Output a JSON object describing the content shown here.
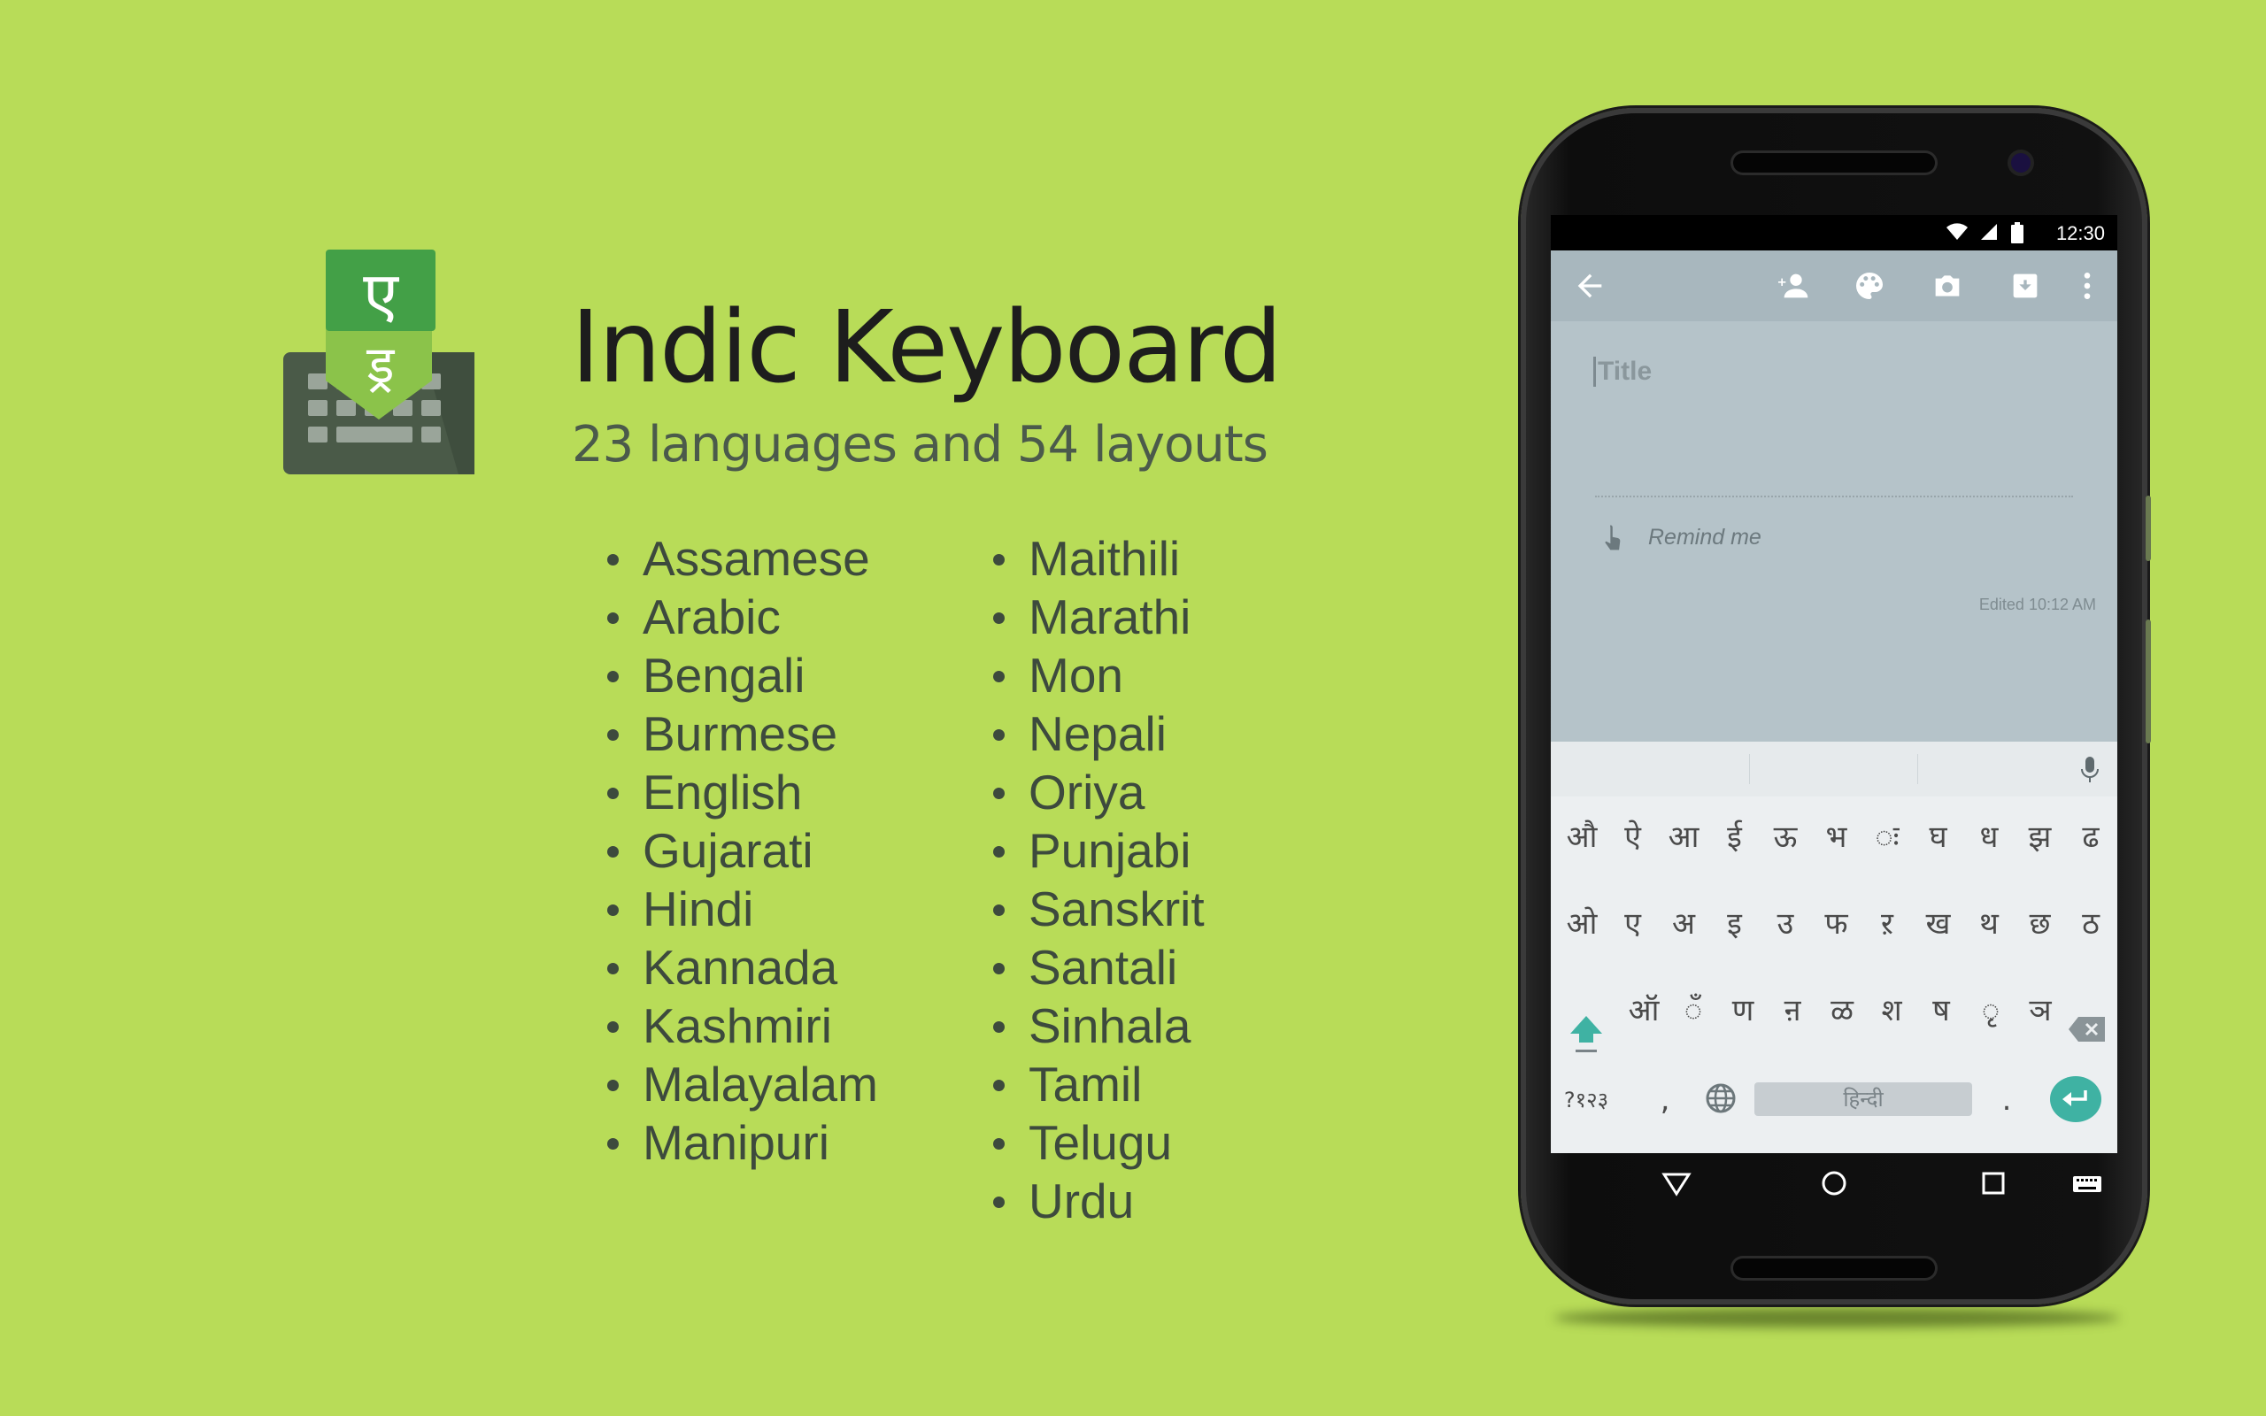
{
  "header": {
    "title": "Indic Keyboard",
    "subtitle": "23 languages and 54 layouts"
  },
  "app_icon": {
    "glyph_top": "ए",
    "glyph_bottom": "ड्र",
    "colors": {
      "badge": "#43a047",
      "ribbon": "#8bc34a",
      "keyboard": "#4a5a48"
    }
  },
  "languages": {
    "column1": [
      "Assamese",
      "Arabic",
      "Bengali",
      "Burmese",
      "English",
      "Gujarati",
      "Hindi",
      "Kannada",
      "Kashmiri",
      "Malayalam",
      "Manipuri"
    ],
    "column2": [
      "Maithili",
      "Marathi",
      "Mon",
      "Nepali",
      "Oriya",
      "Punjabi",
      "Sanskrit",
      "Santali",
      "Sinhala",
      "Tamil",
      "Telugu",
      "Urdu"
    ]
  },
  "phone": {
    "status_bar": {
      "time": "12:30",
      "icons": [
        "wifi-icon",
        "signal-icon",
        "battery-icon"
      ]
    },
    "toolbar": {
      "icons": [
        "back-arrow-icon",
        "add-person-icon",
        "palette-icon",
        "camera-icon",
        "archive-icon",
        "more-vert-icon"
      ]
    },
    "note": {
      "title_placeholder": "Title",
      "remind_label": "Remind me",
      "edited_label": "Edited 10:12 AM"
    },
    "keyboard": {
      "row1": [
        "औ",
        "ऐ",
        "आ",
        "ई",
        "ऊ",
        "भ",
        "ः",
        "घ",
        "ध",
        "झ",
        "ढ"
      ],
      "row2": [
        "ओ",
        "ए",
        "अ",
        "इ",
        "उ",
        "फ",
        "ऱ",
        "ख",
        "थ",
        "छ",
        "ठ"
      ],
      "row3": [
        "ऑ",
        "ँ",
        "ण",
        "ऩ",
        "ळ",
        "श",
        "ष",
        "ृ",
        "ञ"
      ],
      "symbols_key": "?१२३",
      "comma_key": ",",
      "period_key": ".",
      "space_label": "हिन्दी",
      "accent_color": "#3fb2a3"
    },
    "nav": {
      "icons": [
        "back-triangle-icon",
        "home-circle-icon",
        "recents-square-icon",
        "keyboard-icon"
      ]
    }
  }
}
